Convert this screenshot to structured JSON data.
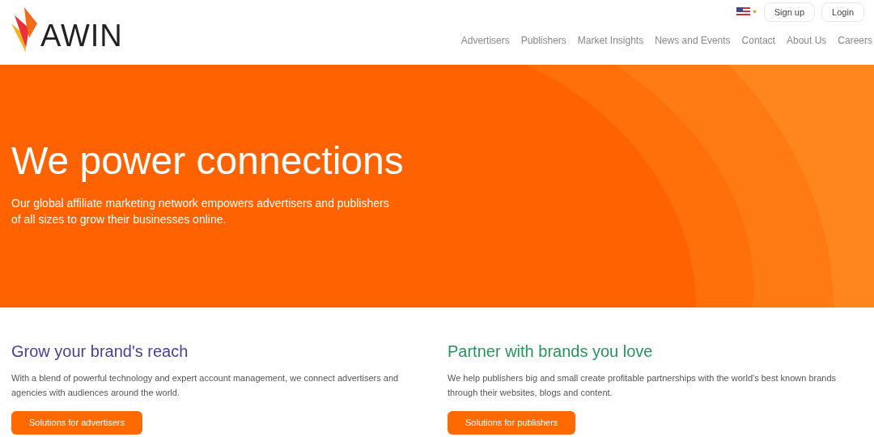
{
  "header": {
    "logo": "AWIN",
    "utility": {
      "sign_up": "Sign up",
      "login": "Login"
    },
    "nav": [
      "Advertisers",
      "Publishers",
      "Market Insights",
      "News and Events",
      "Contact",
      "About Us",
      "Careers"
    ]
  },
  "hero": {
    "title": "We power connections",
    "subtitle": "Our global affiliate marketing network empowers advertisers and publishers of all sizes to grow their businesses online."
  },
  "columns": [
    {
      "title": "Grow your brand's reach",
      "color": "#4a3f97",
      "text": "With a blend of powerful technology and expert account management, we connect advertisers and agencies with audiences around the world.",
      "button": "Solutions for advertisers"
    },
    {
      "title": "Partner with brands you love",
      "color": "#23955a",
      "text": "We help publishers big and small create profitable partnerships with the world's best known brands through their websites, blogs and content.",
      "button": "Solutions for publishers"
    }
  ]
}
